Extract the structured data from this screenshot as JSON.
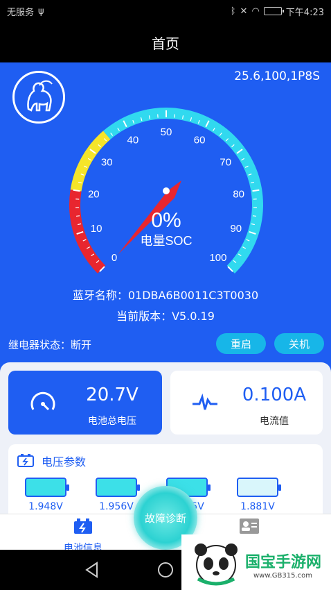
{
  "status_bar": {
    "carrier": "无服务",
    "time": "下午4:23"
  },
  "header": {
    "title": "首页"
  },
  "device": {
    "model": "25.6,100,1P8S"
  },
  "gauge": {
    "value": 0,
    "value_text": "0%",
    "label": "电量SOC",
    "ticks": [
      "0",
      "10",
      "20",
      "30",
      "40",
      "50",
      "60",
      "70",
      "80",
      "90",
      "100"
    ],
    "colors": {
      "red": "#e8262f",
      "yellow": "#f5e52a",
      "cyan": "#31d9ef"
    }
  },
  "info": {
    "bluetooth": "蓝牙名称：01DBA6B0011C3T0030",
    "version": "当前版本：V5.0.19",
    "relay_status": "继电器状态：断开"
  },
  "buttons": {
    "restart": "重启",
    "power_off": "关机"
  },
  "cards": {
    "total_voltage": {
      "value": "20.7V",
      "label": "电池总电压"
    },
    "current": {
      "value": "0.100A",
      "label": "电流值"
    }
  },
  "voltage_params": {
    "title": "电压参数",
    "cells": [
      "1.948V",
      "1.956V",
      "1.955V",
      "1.881V"
    ]
  },
  "tabbar": {
    "battery_info": "电池信息",
    "fault_diag": "故障诊断"
  },
  "watermark": {
    "name": "国宝手游网",
    "url": "www.GB315.com"
  },
  "colors": {
    "brand_blue": "#1f5ef2",
    "accent_cyan": "#17b6e8"
  }
}
